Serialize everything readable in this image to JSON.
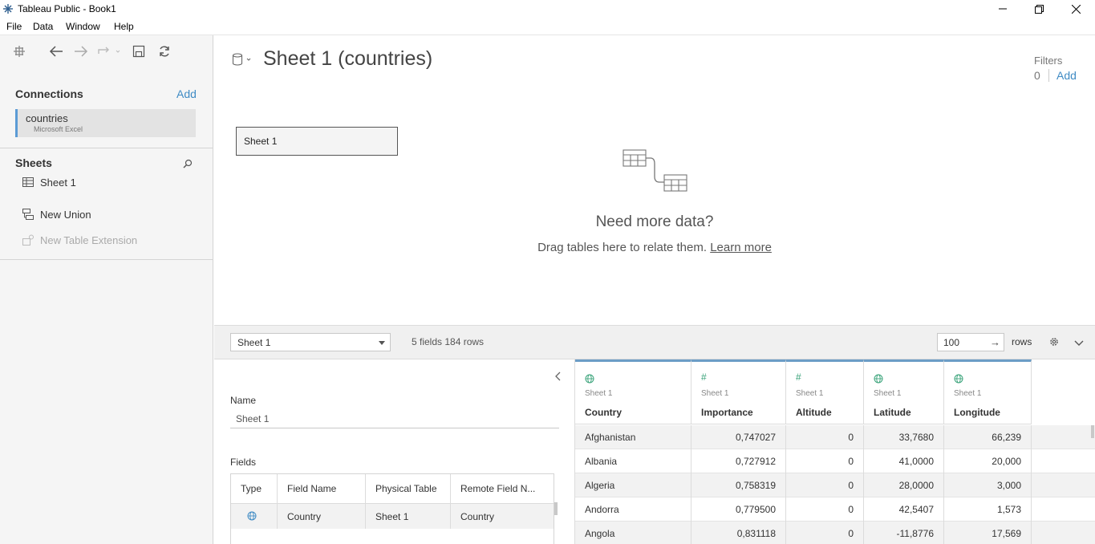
{
  "window": {
    "title": "Tableau Public - Book1"
  },
  "menu": [
    "File",
    "Data",
    "Window",
    "Help"
  ],
  "connections": {
    "header": "Connections",
    "add_label": "Add",
    "items": [
      {
        "name": "countries",
        "type": "Microsoft Excel"
      }
    ]
  },
  "sheets": {
    "header": "Sheets",
    "items": [
      {
        "label": "Sheet 1"
      }
    ],
    "new_union": "New Union",
    "new_table_extension": "New Table Extension"
  },
  "canvas": {
    "datasource_title": "Sheet 1 (countries)",
    "filters_label": "Filters",
    "filters_count": "0",
    "filters_add": "Add",
    "table_box_label": "Sheet 1",
    "need_more": "Need more data?",
    "drag_hint": "Drag tables here to relate them.",
    "learn_more": "Learn more"
  },
  "grid_toolbar": {
    "table_select": "Sheet 1",
    "fields_rows": "5 fields 184 rows",
    "rows_value": "100",
    "rows_label": "rows"
  },
  "metadata": {
    "name_label": "Name",
    "name_value": "Sheet 1",
    "fields_label": "Fields",
    "columns": [
      "Type",
      "Field Name",
      "Physical Table",
      "Remote Field N..."
    ],
    "rows": [
      {
        "type_icon": "globe-icon",
        "field_name": "Country",
        "physical_table": "Sheet 1",
        "remote_field": "Country"
      }
    ]
  },
  "data_grid": {
    "columns": [
      {
        "icon": "globe-icon",
        "source": "Sheet 1",
        "name": "Country"
      },
      {
        "icon": "hash-icon",
        "source": "Sheet 1",
        "name": "Importance"
      },
      {
        "icon": "hash-icon",
        "source": "Sheet 1",
        "name": "Altitude"
      },
      {
        "icon": "globe-icon",
        "source": "Sheet 1",
        "name": "Latitude"
      },
      {
        "icon": "globe-icon",
        "source": "Sheet 1",
        "name": "Longitude"
      }
    ],
    "rows": [
      [
        "Afghanistan",
        "0,747027",
        "0",
        "33,7680",
        "66,239"
      ],
      [
        "Albania",
        "0,727912",
        "0",
        "41,0000",
        "20,000"
      ],
      [
        "Algeria",
        "0,758319",
        "0",
        "28,0000",
        "3,000"
      ],
      [
        "Andorra",
        "0,779500",
        "0",
        "42,5407",
        "1,573"
      ],
      [
        "Angola",
        "0,831118",
        "0",
        "-11,8776",
        "17,569"
      ]
    ]
  },
  "colors": {
    "accent": "#3f8bc4",
    "selection_bar": "#5b9bd5",
    "field_icon_green": "#3aa37a"
  }
}
